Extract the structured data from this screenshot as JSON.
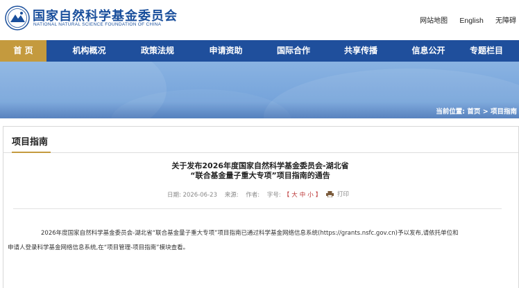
{
  "header": {
    "logo_cn": "国家自然科学基金委员会",
    "logo_en": "NATIONAL NATURAL SCIENCE FOUNDATION OF CHINA",
    "top_links": [
      "网站地图",
      "English",
      "无障碍"
    ]
  },
  "nav": {
    "items": [
      "首 页",
      "机构概况",
      "政策法规",
      "申请资助",
      "国际合作",
      "共享传播",
      "信息公开",
      "专题栏目"
    ],
    "active_index": 0,
    "colors": {
      "bar": "#1f4f9c",
      "active": "#c49a3e"
    }
  },
  "breadcrumb": {
    "prefix": "当前位置:",
    "home": "首页",
    "separator": ">",
    "current": "项目指南"
  },
  "section": {
    "title": "项目指南"
  },
  "article": {
    "title_line1": "关于发布2026年度国家自然科学基金委员会-湖北省",
    "title_line2": "“联合基金量子重大专项”项目指南的通告",
    "meta": {
      "date_label": "日期:",
      "date": "2026-06-23",
      "source_label": "来源:",
      "source": "",
      "author_label": "作者:",
      "author": "",
      "font_size_label": "字号:",
      "bracket_open": "【",
      "font_sizes": [
        "大",
        "中",
        "小"
      ],
      "bracket_close": "】",
      "print_label": "打印"
    },
    "body_line1": "2026年度国家自然科学基金委员会-湖北省“联合基金量子重大专项”项目指南已通过科学基金网络信息系统(https://grants.nsfc.gov.cn)予以发布,请依托单位和",
    "body_line2": "申请人登录科学基金网络信息系统,在“项目管理-项目指南”模块查看。"
  }
}
